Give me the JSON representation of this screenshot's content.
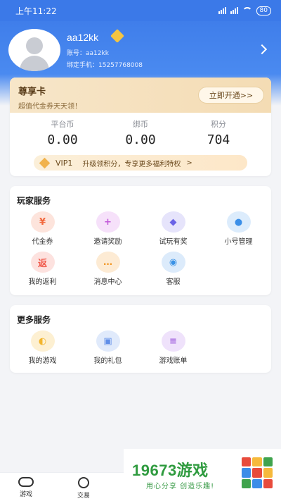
{
  "status_bar": {
    "time": "上午11:22",
    "battery": "80"
  },
  "profile": {
    "username": "aa12kk",
    "account": "账号：aa12kk",
    "phone": "绑定手机：15257768008"
  },
  "premium": {
    "title": "尊享卡",
    "subtitle": "超值代金券天天领！",
    "button": "立即开通>>"
  },
  "wallet": {
    "stats": [
      {
        "label": "平台币",
        "value": "0.00"
      },
      {
        "label": "绑币",
        "value": "0.00"
      },
      {
        "label": "积分",
        "value": "704"
      }
    ],
    "vip_level": "VIP1",
    "vip_text": "升级领积分，专享更多福利特权",
    "vip_arrow": ">"
  },
  "player_services": {
    "title": "玩家服务",
    "items": [
      {
        "label": "代金券",
        "icon": "voucher-icon",
        "glyph": "¥",
        "color": "#f2693e",
        "bg": "#fde4dc"
      },
      {
        "label": "邀请奖励",
        "icon": "invite-icon",
        "glyph": "+",
        "color": "#c259d9",
        "bg": "#f6e1fa"
      },
      {
        "label": "试玩有奖",
        "icon": "gamepad-icon",
        "glyph": "◆",
        "color": "#6a63e6",
        "bg": "#e6e4fb"
      },
      {
        "label": "小号管理",
        "icon": "user-icon",
        "glyph": "●",
        "color": "#3b8fe8",
        "bg": "#dcecfc"
      },
      {
        "label": "我的返利",
        "icon": "rebate-icon",
        "glyph": "返",
        "color": "#f05b4d",
        "bg": "#fde2df"
      },
      {
        "label": "消息中心",
        "icon": "message-icon",
        "glyph": "…",
        "color": "#f39a2b",
        "bg": "#fdebd4"
      },
      {
        "label": "客服",
        "icon": "headset-icon",
        "glyph": "◉",
        "color": "#3a92e6",
        "bg": "#dcebfb"
      }
    ]
  },
  "more_services": {
    "title": "更多服务",
    "items": [
      {
        "label": "我的游戏",
        "icon": "game-icon",
        "glyph": "◐",
        "color": "#f2b52e",
        "bg": "#fdf0d2"
      },
      {
        "label": "我的礼包",
        "icon": "gift-icon",
        "glyph": "▣",
        "color": "#5f8ee8",
        "bg": "#e0eafb"
      },
      {
        "label": "游戏账单",
        "icon": "bill-icon",
        "glyph": "≡",
        "color": "#a86de0",
        "bg": "#efe2fb"
      }
    ]
  },
  "tabbar": {
    "tabs": [
      {
        "label": "游戏"
      },
      {
        "label": "交易"
      }
    ]
  },
  "watermark": {
    "title": "19673游戏",
    "subtitle": "用心分享 创造乐趣!"
  }
}
